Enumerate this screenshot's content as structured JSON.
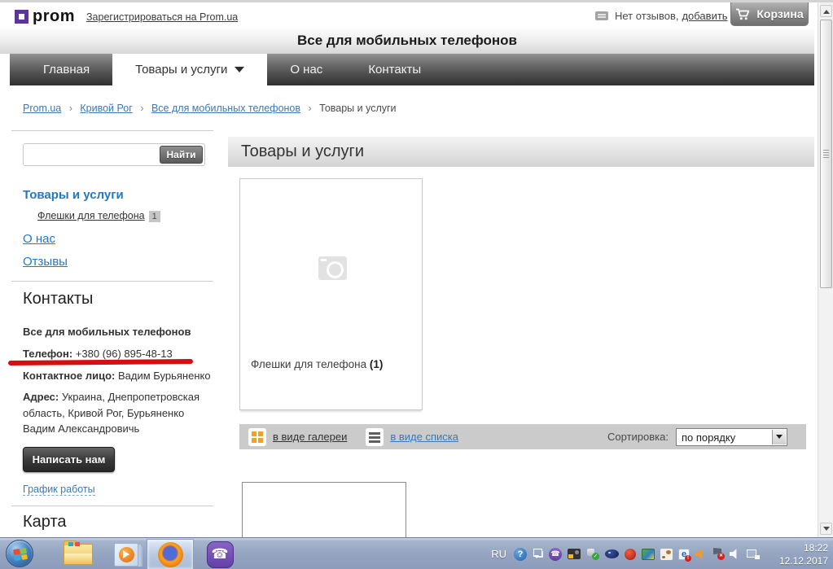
{
  "header": {
    "logo_text": "prom",
    "register_link": "Зарегистрироваться на Prom.ua",
    "reviews_prefix": "Нет отзывов,",
    "reviews_add_link": "добавить",
    "cart_button": "Корзина"
  },
  "banner": {
    "title": "Все для мобильных телефонов"
  },
  "nav": {
    "tabs": [
      {
        "label": "Главная",
        "active": false
      },
      {
        "label": "Товары и услуги",
        "active": true,
        "has_dropdown": true
      },
      {
        "label": "О нас",
        "active": false
      },
      {
        "label": "Контакты",
        "active": false
      }
    ]
  },
  "breadcrumb": {
    "separator": "›",
    "links": [
      "Prom.ua",
      "Кривой Рог",
      "Все для мобильных телефонов"
    ],
    "current": "Товары и услуги"
  },
  "sidebar": {
    "search": {
      "button": "Найти",
      "value": ""
    },
    "catalog_heading": "Товары и услуги",
    "category": {
      "label": "Флешки для телефона",
      "count": "1"
    },
    "about_link": "О нас",
    "reviews_link": "Отзывы",
    "contacts": {
      "heading": "Контакты",
      "company": "Все для мобильных телефонов",
      "phone_label": "Телефон:",
      "phone": "+380 (96) 895-48-13",
      "person_label": "Контактное лицо:",
      "person": "Вадим Бурьяненко",
      "address_label": "Адрес:",
      "address": "Украина, Днепропетровская область, Кривой Рог, Бурьяненко Вадим Александровичь"
    },
    "write_us_button": "Написать нам",
    "schedule_link": "График работы",
    "map_heading": "Карта"
  },
  "main": {
    "heading": "Товары и услуги",
    "category_card": {
      "label": "Флешки для телефона",
      "count": "(1)"
    },
    "toolbar": {
      "gallery_view": "в виде галереи",
      "list_view": "в виде списка",
      "sort_label": "Сортировка:",
      "sort_value": "по порядку"
    }
  },
  "taskbar": {
    "language": "RU",
    "time": "18:22",
    "date": "12.12.2017",
    "apps": [
      "start",
      "explorer",
      "media-player",
      "firefox",
      "viber"
    ],
    "tray_icons": [
      "help",
      "show-hidden",
      "viber",
      "camera",
      "usb-safely-remove",
      "antivirus-oval",
      "download-manager",
      "photos",
      "cat-app",
      "e-alert",
      "volume-mixer",
      "action-center-flag",
      "volume",
      "network"
    ]
  },
  "colors": {
    "brand_purple": "#5b3794",
    "link_blue": "#3b78b5",
    "annotation_red": "#d40f0f",
    "nav_dark": "#2f2f2f",
    "taskbar_blue": "#94a4c0"
  }
}
